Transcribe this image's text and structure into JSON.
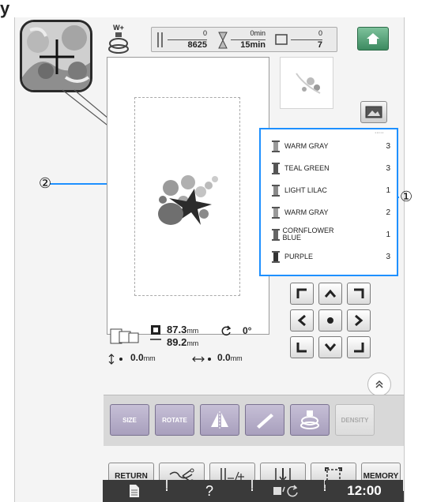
{
  "heading": "y",
  "screen": {
    "header": {
      "stitch_count": "8625",
      "stitch_current": "0",
      "time_elapsed": "0min",
      "time_total": "15min",
      "color_current": "0",
      "color_total": "7",
      "foot_label": "W+"
    },
    "callouts": {
      "one": "①",
      "two": "②"
    },
    "threads": [
      {
        "name": "WARM GRAY",
        "count": "3",
        "color": "#9a9a9a"
      },
      {
        "name": "TEAL GREEN",
        "count": "3",
        "color": "#555555"
      },
      {
        "name": "LIGHT LILAC",
        "count": "1",
        "color": "#8a8a8a"
      },
      {
        "name": "WARM GRAY",
        "count": "2",
        "color": "#9a9a9a"
      },
      {
        "name": "CORNFLOWER BLUE",
        "count": "1",
        "color": "#666666"
      },
      {
        "name": "PURPLE",
        "count": "3",
        "color": "#333333"
      }
    ],
    "threads_indicator": "·····",
    "position": {
      "width": "87.3",
      "height": "89.2",
      "unit": "mm",
      "angle": "0°",
      "v_offset": "0.0",
      "h_offset": "0.0"
    },
    "edit_buttons": {
      "size": "SIZE",
      "rotate": "ROTATE",
      "density": "DENSITY"
    },
    "bottom_buttons": {
      "return": "RETURN",
      "memory": "MEMORY"
    },
    "status": {
      "help": "?",
      "clock": "12:00"
    },
    "colors": {
      "highlight": "#1e90ff",
      "callout_line": "#1e90ff",
      "status_bar": "#3a3a3a",
      "edit_button": "#b6aecb"
    }
  }
}
